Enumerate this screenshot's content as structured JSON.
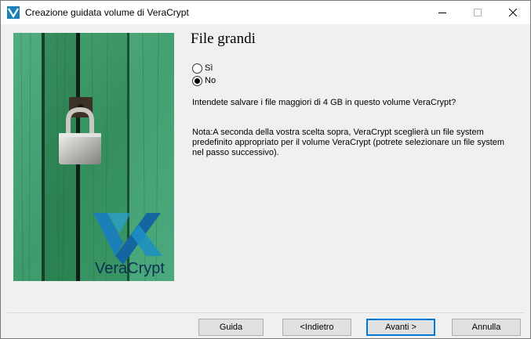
{
  "window": {
    "title": "Creazione guidata volume di VeraCrypt",
    "accent": "#0078d7"
  },
  "banner": {
    "brand": "VeraCrypt",
    "colors": {
      "door": "#2f8a57",
      "logo": "#1b80b8"
    }
  },
  "page": {
    "title": "File grandi",
    "options": [
      {
        "label": "Sì",
        "selected": false
      },
      {
        "label": "No",
        "selected": true
      }
    ],
    "question": "Intendete salvare i file maggiori di 4 GB in questo volume VeraCrypt?",
    "note": "Nota:A seconda della vostra scelta sopra, VeraCrypt sceglierà un file system predefinito appropriato per il volume VeraCrypt (potrete selezionare un file system nel passo successivo)."
  },
  "buttons": {
    "help": "Guida",
    "back": "<Indietro",
    "next": "Avanti >",
    "cancel": "Annulla"
  }
}
